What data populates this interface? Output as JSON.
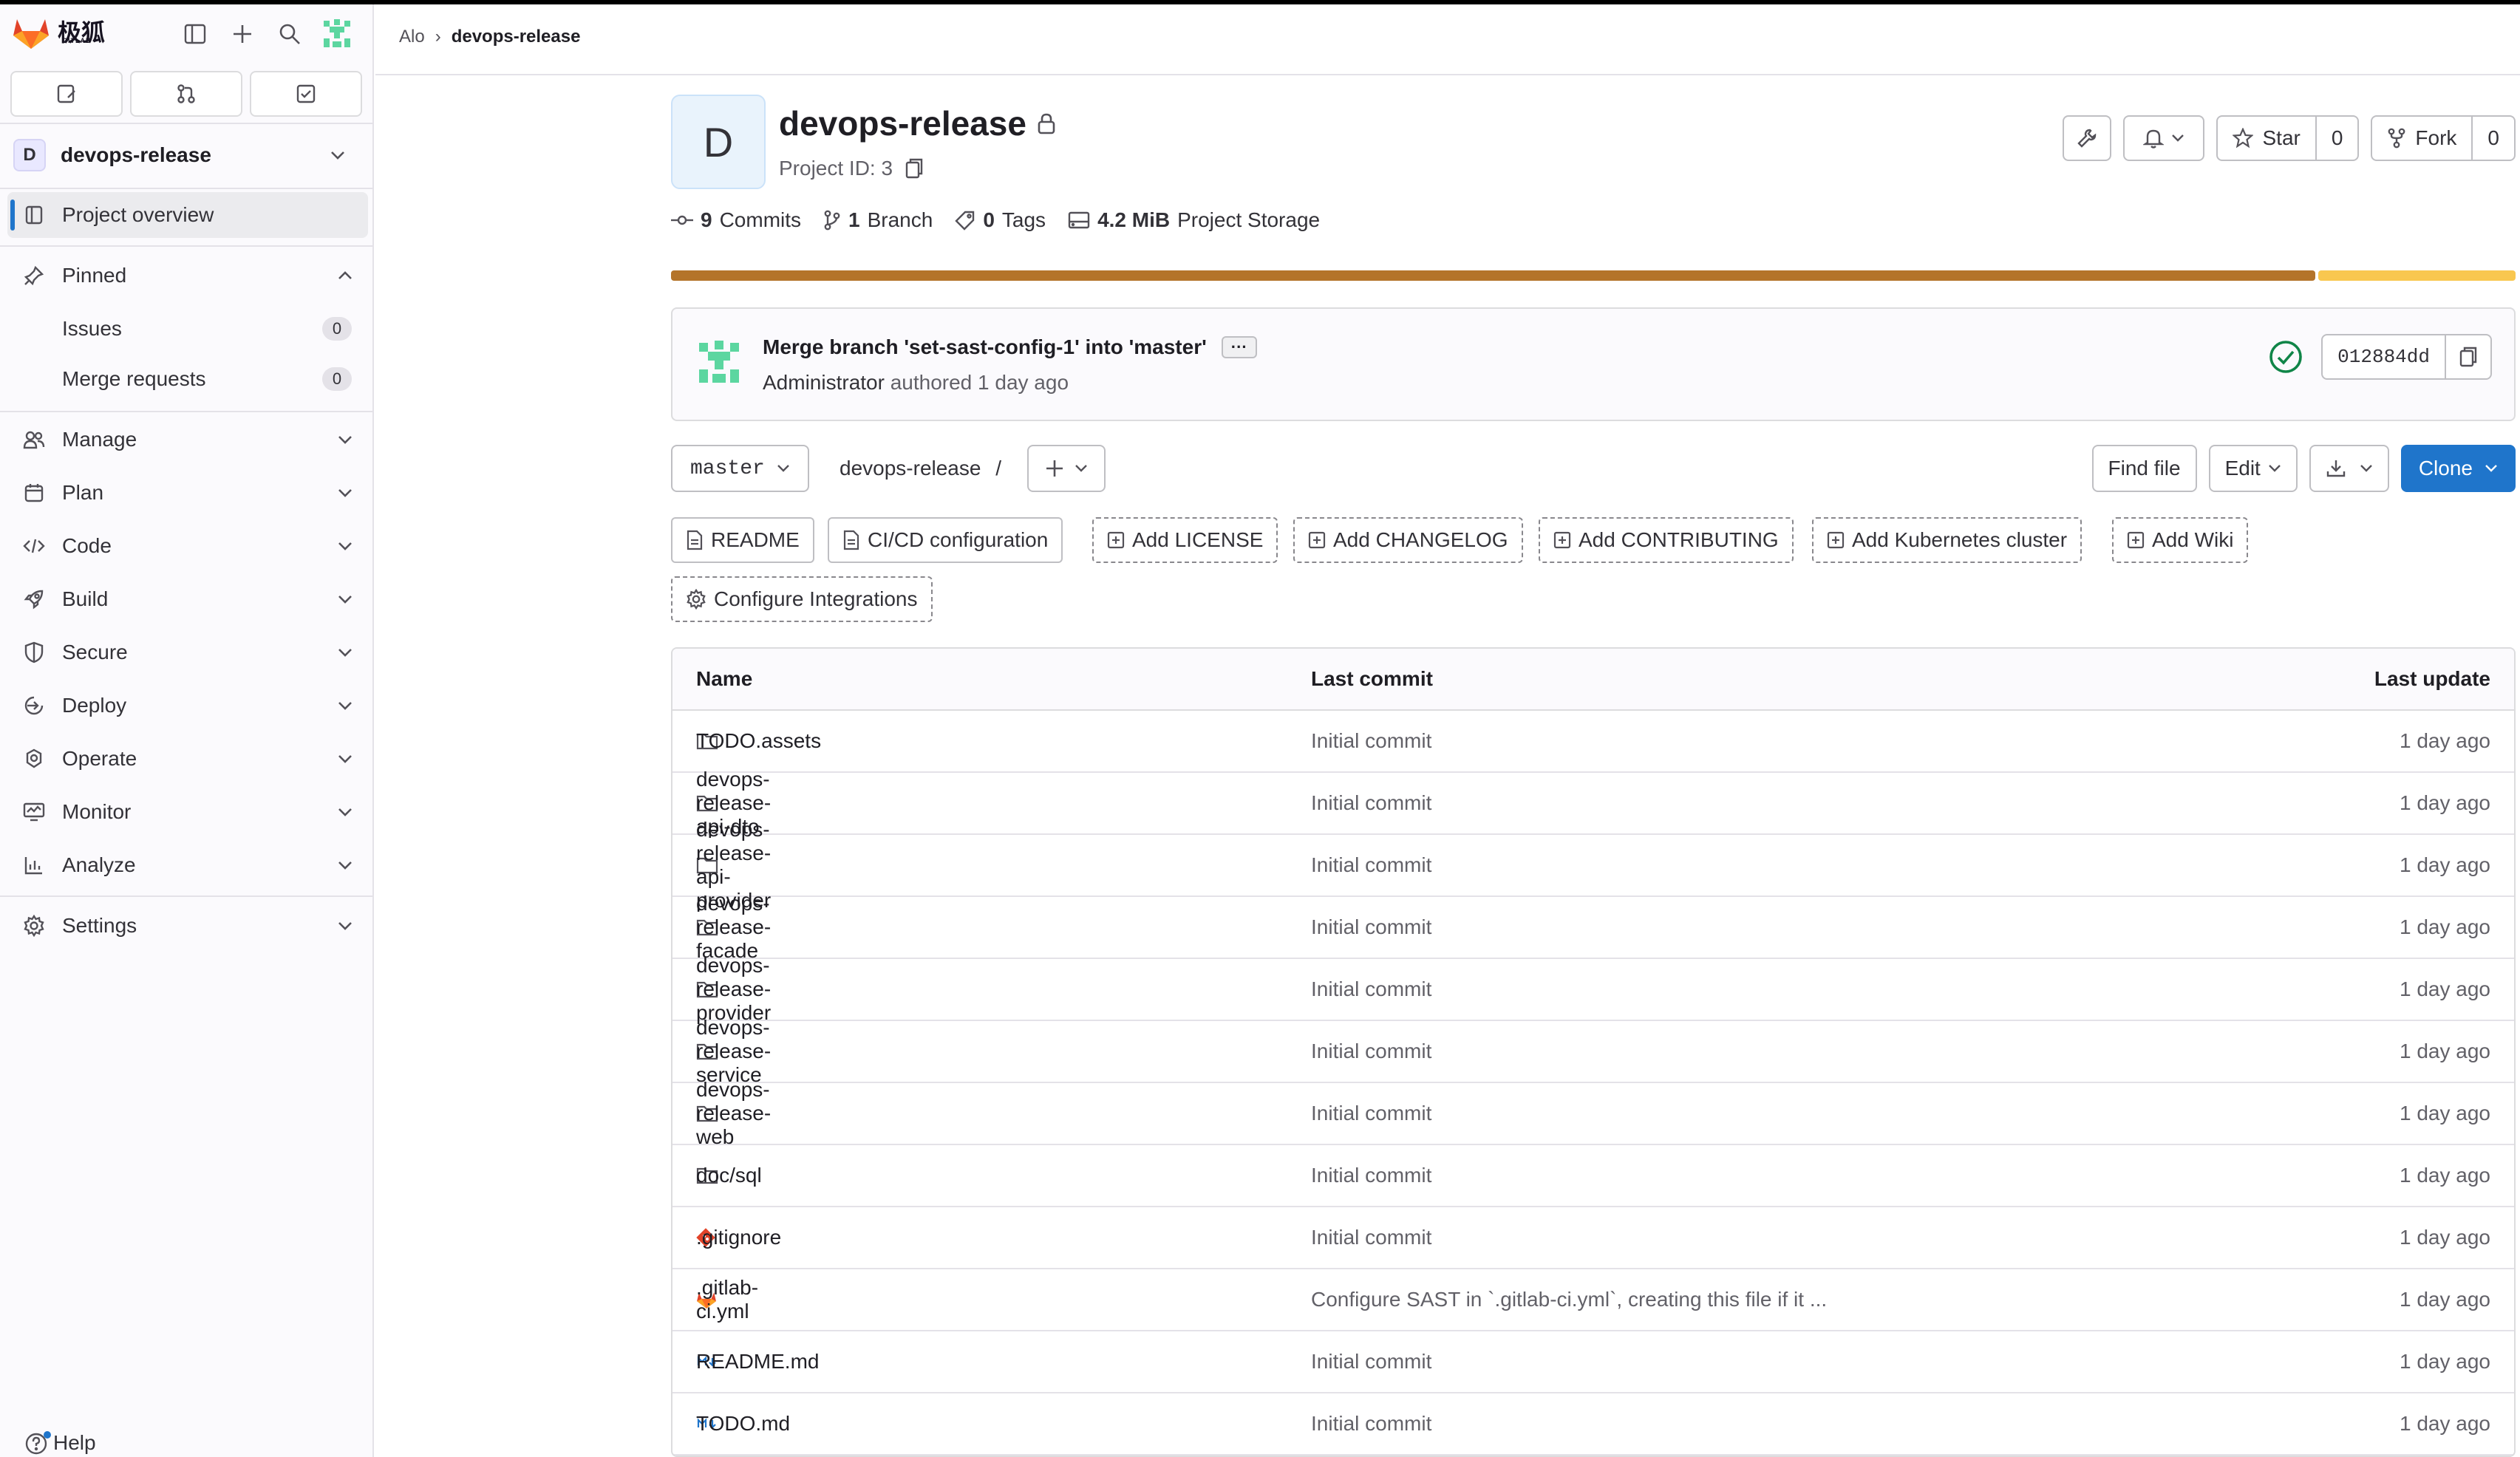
{
  "app": {
    "logo_text": "极狐",
    "logo_sub": "GITLAB"
  },
  "sidebar": {
    "project": {
      "avatar_letter": "D",
      "name": "devops-release"
    },
    "overview": "Project overview",
    "pinned": "Pinned",
    "pinned_items": [
      {
        "label": "Issues",
        "count": "0"
      },
      {
        "label": "Merge requests",
        "count": "0"
      }
    ],
    "sections": [
      "Manage",
      "Plan",
      "Code",
      "Build",
      "Secure",
      "Deploy",
      "Operate",
      "Monitor",
      "Analyze",
      "Settings"
    ],
    "help": "Help"
  },
  "breadcrumb": {
    "parent": "Alo",
    "separator": "›",
    "current": "devops-release"
  },
  "project": {
    "avatar_letter": "D",
    "title": "devops-release",
    "id_label": "Project ID: 3",
    "star_label": "Star",
    "star_count": "0",
    "fork_label": "Fork",
    "fork_count": "0",
    "stats": {
      "commits_num": "9",
      "commits_label": "Commits",
      "branch_num": "1",
      "branch_label": "Branch",
      "tags_num": "0",
      "tags_label": "Tags",
      "storage_num": "4.2 MiB",
      "storage_label": "Project Storage"
    },
    "language_bar": [
      {
        "color": "#b4742a",
        "fraction": 0.893
      },
      {
        "color": "#f9c74f",
        "fraction": 0.107
      }
    ]
  },
  "last_commit": {
    "title": "Merge branch 'set-sast-config-1' into 'master'",
    "author": "Administrator",
    "authored": "authored 1 day ago",
    "sha": "012884dd",
    "status_color": "#108548"
  },
  "toolbar": {
    "branch": "master",
    "path": "devops-release",
    "path_sep": "/",
    "find_file": "Find file",
    "edit": "Edit",
    "clone": "Clone",
    "accent": "#1f75cb"
  },
  "chips": {
    "readme": "README",
    "cicd": "CI/CD configuration",
    "license": "Add LICENSE",
    "changelog": "Add CHANGELOG",
    "contributing": "Add CONTRIBUTING",
    "k8s": "Add Kubernetes cluster",
    "wiki": "Add Wiki",
    "integrations": "Configure Integrations"
  },
  "files": {
    "headers": {
      "name": "Name",
      "last_commit": "Last commit",
      "last_update": "Last update"
    },
    "rows": [
      {
        "icon": "folder-icon",
        "name": "TODO.assets",
        "commit": "Initial commit",
        "updated": "1 day ago"
      },
      {
        "icon": "folder-icon",
        "name": "devops-release-api-dto",
        "commit": "Initial commit",
        "updated": "1 day ago"
      },
      {
        "icon": "folder-icon",
        "name": "devops-release-api-provider",
        "commit": "Initial commit",
        "updated": "1 day ago"
      },
      {
        "icon": "folder-icon",
        "name": "devops-release-facade",
        "commit": "Initial commit",
        "updated": "1 day ago"
      },
      {
        "icon": "folder-icon",
        "name": "devops-release-provider",
        "commit": "Initial commit",
        "updated": "1 day ago"
      },
      {
        "icon": "folder-icon",
        "name": "devops-release-service",
        "commit": "Initial commit",
        "updated": "1 day ago"
      },
      {
        "icon": "folder-icon",
        "name": "devops-release-web",
        "commit": "Initial commit",
        "updated": "1 day ago"
      },
      {
        "icon": "folder-icon",
        "name": "doc/sql",
        "commit": "Initial commit",
        "updated": "1 day ago"
      },
      {
        "icon": "git-icon",
        "name": ".gitignore",
        "commit": "Initial commit",
        "updated": "1 day ago"
      },
      {
        "icon": "gitlab-icon",
        "name": ".gitlab-ci.yml",
        "commit": "Configure SAST in `.gitlab-ci.yml`, creating this file if it ...",
        "updated": "1 day ago"
      },
      {
        "icon": "markdown-icon",
        "name": "README.md",
        "commit": "Initial commit",
        "updated": "1 day ago"
      },
      {
        "icon": "markdown-icon",
        "name": "TODO.md",
        "commit": "Initial commit",
        "updated": "1 day ago"
      }
    ]
  }
}
